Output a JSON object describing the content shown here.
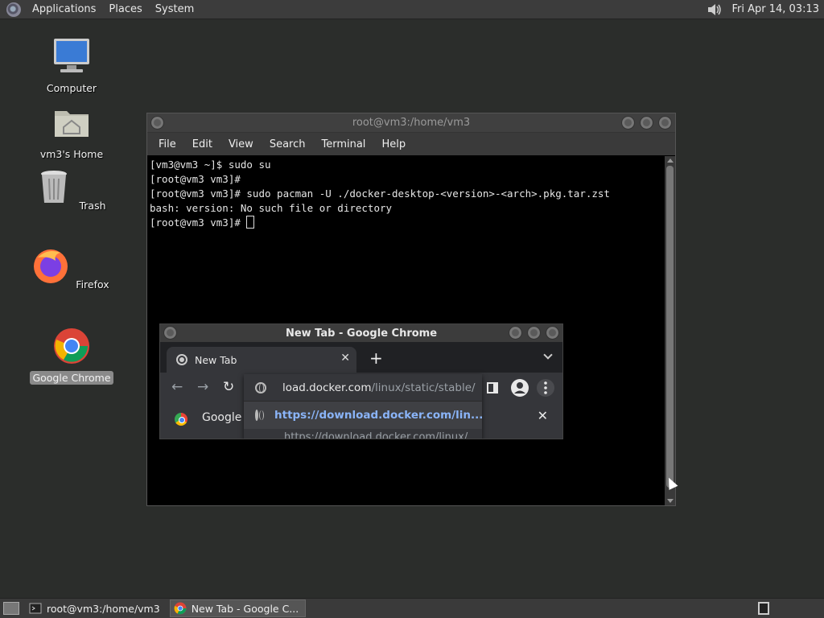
{
  "top_panel": {
    "menus": [
      "Applications",
      "Places",
      "System"
    ],
    "clock": "Fri Apr 14, 03:13"
  },
  "desktop": {
    "icons": [
      {
        "label": "Computer",
        "icon": "computer-icon"
      },
      {
        "label": "vm3's Home",
        "icon": "home-folder-icon"
      },
      {
        "label": "Trash",
        "icon": "trash-icon"
      },
      {
        "label": "Firefox",
        "icon": "firefox-icon"
      },
      {
        "label": "Google Chrome",
        "icon": "chrome-icon"
      }
    ]
  },
  "terminal": {
    "title": "root@vm3:/home/vm3",
    "menu": [
      "File",
      "Edit",
      "View",
      "Search",
      "Terminal",
      "Help"
    ],
    "lines": [
      "[vm3@vm3 ~]$ sudo su",
      "[root@vm3 vm3]#",
      "[root@vm3 vm3]# sudo pacman -U ./docker-desktop-<version>-<arch>.pkg.tar.zst",
      "bash: version: No such file or directory",
      "[root@vm3 vm3]# "
    ]
  },
  "chrome": {
    "title": "New Tab - Google Chrome",
    "tab_label": "New Tab",
    "omnibox_prefix": "load.docker.com",
    "omnibox_suffix": "/linux/static/stable/",
    "suggestion_1": "https://download.docker.com/lin...",
    "suggestion_2": "https://download.docker.com/linux/",
    "bookmark_label": "Google"
  },
  "taskbar": {
    "items": [
      "root@vm3:/home/vm3",
      "New Tab - Google C..."
    ]
  }
}
